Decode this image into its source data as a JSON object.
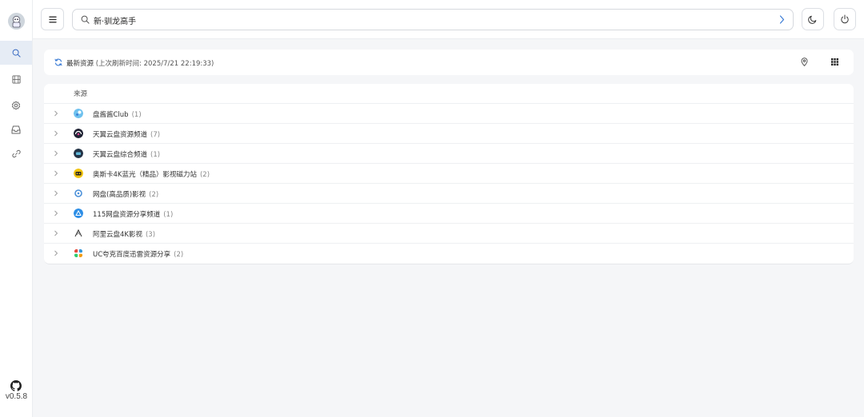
{
  "app": {
    "version": "v0.5.8"
  },
  "search": {
    "value": "新·驯龙高手",
    "placeholder": ""
  },
  "header": {
    "menu_icon": "menu-icon",
    "go_icon": "chevron-right-icon",
    "theme_icon": "moon-icon",
    "power_icon": "power-icon"
  },
  "sidebar": {
    "items": [
      {
        "name": "search",
        "icon": "search-icon",
        "active": true
      },
      {
        "name": "films",
        "icon": "film-icon",
        "active": false
      },
      {
        "name": "settings",
        "icon": "gear-icon",
        "active": false
      },
      {
        "name": "inbox",
        "icon": "inbox-icon",
        "active": false
      },
      {
        "name": "links",
        "icon": "link-icon",
        "active": false
      }
    ]
  },
  "info": {
    "title": "最新资源",
    "subtitle": "(上次刷新时间:  2025/7/21 22:19:33)"
  },
  "table": {
    "header": "来源",
    "rows": [
      {
        "name": "盘酱酱Club",
        "count": "(1)",
        "color": "#5aa7e8"
      },
      {
        "name": "天翼云盘资源频道",
        "count": "(7)",
        "color": "#1f2233"
      },
      {
        "name": "天翼云盘综合频道",
        "count": "(1)",
        "color": "#2a3a4a"
      },
      {
        "name": "奥斯卡4K蓝光（精品）影视磁力站",
        "count": "(2)",
        "color": "#f1c40f"
      },
      {
        "name": "网盘(高品质)影视",
        "count": "(2)",
        "color": "#4a90d9"
      },
      {
        "name": "115网盘资源分享频道",
        "count": "(1)",
        "color": "#2d8ee6"
      },
      {
        "name": "阿里云盘4K影视",
        "count": "(3)",
        "color": "#ffffff"
      },
      {
        "name": "UC夸克百度迅雷资源分享",
        "count": "(2)",
        "color": "#ffffff"
      }
    ]
  },
  "colors": {
    "accent": "#3a7bd5",
    "sidebar_active_bg": "#e6ecf5",
    "page_bg": "#f5f6f8"
  }
}
